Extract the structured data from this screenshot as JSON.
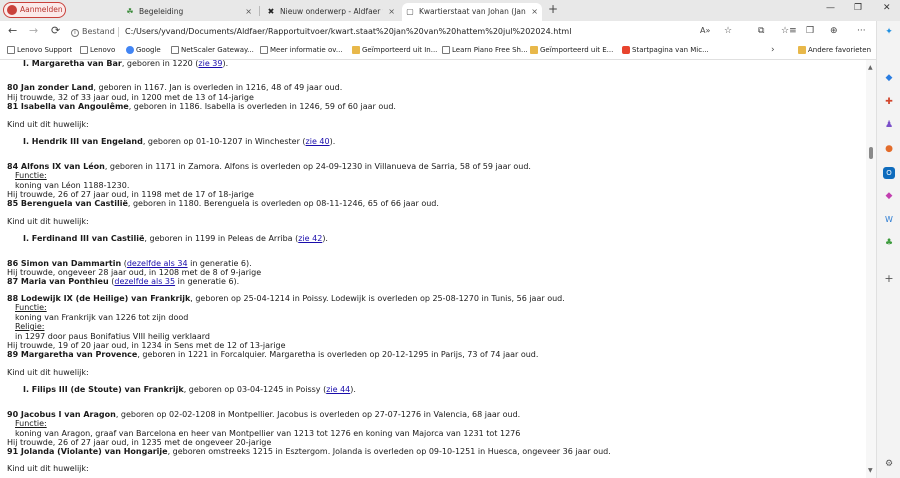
{
  "tabs": {
    "profile_label": "Aanmelden",
    "items": [
      {
        "title": "Begeleiding",
        "icon": "☘"
      },
      {
        "title": "Nieuw onderwerp - Aldfaer forum",
        "icon": "✖"
      },
      {
        "title": "Kwartierstaat van Johan (Jan) van",
        "icon": "▢"
      }
    ],
    "close_glyph": "×",
    "new_tab_glyph": "+"
  },
  "window": {
    "minimize": "—",
    "maximize": "❐",
    "close": "✕"
  },
  "address": {
    "back": "←",
    "forward": "→",
    "reload": "⟳",
    "scheme_label": "Bestand",
    "url": "C:/Users/yvand/Documents/Aldfaer/Rapportuitvoer/kwart.staat%20jan%20van%20hattem%20jul%202024.html",
    "read_aloud": "A»",
    "favorite": "☆",
    "split": "⧉",
    "collections": "❒",
    "extensions": "☆≡",
    "copilot_icon": "⊕",
    "more": "···"
  },
  "bookmarks": [
    {
      "label": "Lenovo Support",
      "icon": "page"
    },
    {
      "label": "Lenovo",
      "icon": "page"
    },
    {
      "label": "Google",
      "icon": "goog"
    },
    {
      "label": "NetScaler Gateway...",
      "icon": "page"
    },
    {
      "label": "Meer informatie ov...",
      "icon": "page"
    },
    {
      "label": "Geïmporteerd uit In...",
      "icon": "fold"
    },
    {
      "label": "Learn Piano Free Sh...",
      "icon": "page"
    },
    {
      "label": "Geïmporteerd uit E...",
      "icon": "fold"
    },
    {
      "label": "Startpagina van Mic...",
      "icon": "ms"
    }
  ],
  "bookmarks_more": "›",
  "bookmarks_other": "Andere favorieten",
  "doc": {
    "l0": {
      "name": "I. Margaretha van Bar",
      "rest": ", geboren in 1220 (",
      "link": "zie 39",
      "end": ")."
    },
    "l1": {
      "name": "80 Jan zonder Land",
      "rest": ", geboren in 1167. Jan is overleden in 1216, 48 of 49 jaar oud."
    },
    "l2": {
      "text": "Hij trouwde, 32 of 33 jaar oud, in 1200 met de 13 of 14-jarige"
    },
    "l3": {
      "name": "81 Isabella van Angoulême",
      "rest": ", geboren in 1186. Isabella is overleden in 1246, 59 of 60 jaar oud."
    },
    "l4": {
      "text": "Kind uit dit huwelijk:"
    },
    "l5": {
      "name": "I. Hendrik III van Engeland",
      "rest": ", geboren op 01-10-1207 in Winchester (",
      "link": "zie 40",
      "end": ")."
    },
    "l6": {
      "name": "84 Alfons IX van Léon",
      "rest": ", geboren in 1171 in Zamora. Alfons is overleden op 24-09-1230 in Villanueva de Sarria, 58 of 59 jaar oud."
    },
    "l7": {
      "text": "Functie:"
    },
    "l8": {
      "text": "koning van Léon 1188-1230."
    },
    "l9": {
      "text": "Hij trouwde, 26 of 27 jaar oud, in 1198 met de 17 of 18-jarige"
    },
    "l10": {
      "name": "85 Berenguela van Castilië",
      "rest": ", geboren in 1180. Berenguela is overleden op 08-11-1246, 65 of 66 jaar oud."
    },
    "l11": {
      "text": "Kind uit dit huwelijk:"
    },
    "l12": {
      "name": "I. Ferdinand III van Castilië",
      "rest": ", geboren in 1199 in Peleas de Arriba (",
      "link": "zie 42",
      "end": ")."
    },
    "l13": {
      "name": "86 Simon van Dammartin",
      "rest": " (",
      "link": "dezelfde als 34",
      "end": " in generatie 6)."
    },
    "l14": {
      "text": "Hij trouwde, ongeveer 28 jaar oud, in 1208 met de 8 of 9-jarige"
    },
    "l15": {
      "name": "87 Maria van Ponthieu",
      "rest": " (",
      "link": "dezelfde als 35",
      "end": " in generatie 6)."
    },
    "l16": {
      "name": "88 Lodewijk IX (de Heilige) van Frankrijk",
      "rest": ", geboren op 25-04-1214 in Poissy. Lodewijk is overleden op 25-08-1270 in Tunis, 56 jaar oud."
    },
    "l17": {
      "text": "Functie:"
    },
    "l18": {
      "text": "koning van Frankrijk van 1226 tot zijn dood"
    },
    "l19": {
      "text": "Religie:"
    },
    "l20": {
      "text": "in 1297 door paus Bonifatius VIII heilig verklaard"
    },
    "l21": {
      "text": "Hij trouwde, 19 of 20 jaar oud, in 1234 in Sens met de 12 of 13-jarige"
    },
    "l22": {
      "name": "89 Margaretha van Provence",
      "rest": ", geboren in 1221 in Forcalquier. Margaretha is overleden op 20-12-1295 in Parijs, 73 of 74 jaar oud."
    },
    "l23": {
      "text": "Kind uit dit huwelijk:"
    },
    "l24": {
      "name": "I. Filips III (de Stoute) van Frankrijk",
      "rest": ", geboren op 03-04-1245 in Poissy (",
      "link": "zie 44",
      "end": ")."
    },
    "l25": {
      "name": "90 Jacobus I van Aragon",
      "rest": ", geboren op 02-02-1208 in Montpellier. Jacobus is overleden op 27-07-1276 in Valencia, 68 jaar oud."
    },
    "l26": {
      "text": "Functie:"
    },
    "l27": {
      "text": "koning van Aragon, graaf van Barcelona en heer van Montpellier van 1213 tot 1276 en koning van Majorca van 1231 tot 1276"
    },
    "l28": {
      "text": "Hij trouwde, 26 of 27 jaar oud, in 1235 met de ongeveer 20-jarige"
    },
    "l29": {
      "name": "91 Jolanda (Violante) van Hongarije",
      "rest": ", geboren omstreeks 1215 in Esztergom. Jolanda is overleden op 09-10-1251 in Huesca, ongeveer 36 jaar oud."
    },
    "l30": {
      "text": "Kind uit dit huwelijk:"
    }
  },
  "scroll": {
    "position_fraction": 0.22,
    "up": "▲",
    "down": "▼"
  },
  "sidebar_icons": [
    "copilot-icon",
    "shopping-icon",
    "tools-icon",
    "games-icon",
    "office-icon",
    "outlook-icon",
    "designer-icon",
    "word-icon",
    "tree-icon",
    "add-icon",
    "settings-icon"
  ],
  "sidebar_glyphs": [
    "✦",
    "◆",
    "✚",
    "♟",
    "●",
    "O",
    "◆",
    "W",
    "♣",
    "+",
    "⚙"
  ]
}
